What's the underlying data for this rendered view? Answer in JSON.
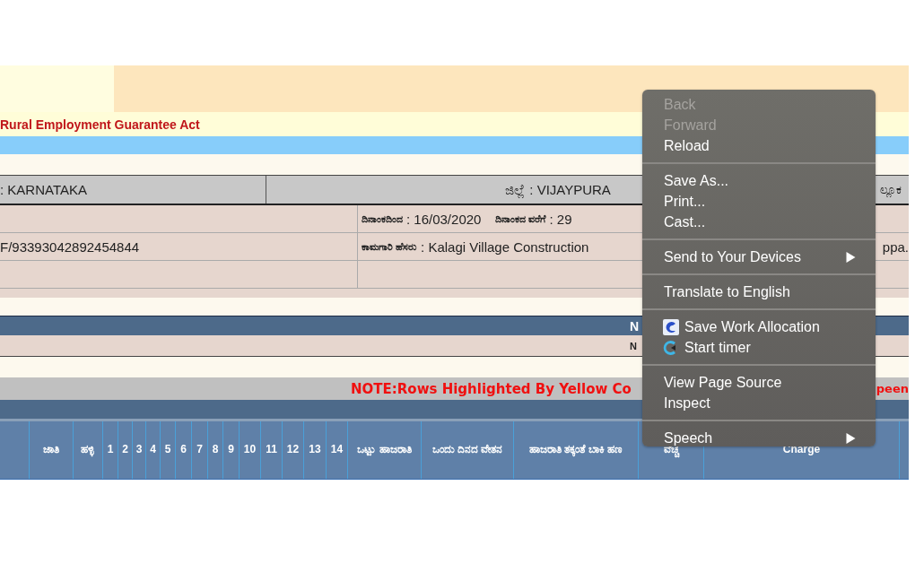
{
  "page": {
    "act_title": "Rural Employment Guarantee Act",
    "location_row": {
      "state": ": KARNATAKA",
      "district": "ಜಿಲ್ಲೆ : VIJAYPURA",
      "taluk": "ಲ್ಲೂಕ"
    },
    "date_row": {
      "from_label": "ದಿನಾಂಕದಿಂದ",
      "from_value": ": 16/03/2020",
      "to_label": "ದಿನಾಂಕದ ವರೆಗೆ",
      "to_value": ": 29"
    },
    "work_row": {
      "work_code": "F/93393042892454844",
      "name_label": "ಕಾಮಗಾರಿ ಹೆಸರು",
      "name_value": ": Kalagi Village Construction",
      "right_text": "ppa."
    },
    "bar_text": "N",
    "sub_bar_text": "N",
    "note": "NOTE:Rows Highlighted By Yellow Co",
    "note_right": "peen",
    "columns": [
      "",
      "ಜಾತಿ",
      "ಹಳ್ಳಿ",
      "1",
      "2",
      "3",
      "4",
      "5",
      "6",
      "7",
      "8",
      "9",
      "10",
      "11",
      "12",
      "13",
      "14",
      "ಒಟ್ಟು ಹಾಜರಾತಿ",
      "ಒಂದು ದಿನದ ವೇತನ",
      "ಹಾಜರಾತಿ ತಕ್ಕಂತೆ ಬಾಕಿ ಹಣ",
      "ವೆಚ್ಚ",
      "Charge"
    ]
  },
  "context_menu": {
    "sections": [
      [
        {
          "label": "Back",
          "kind": "plain",
          "disabled": true
        },
        {
          "label": "Forward",
          "kind": "plain",
          "disabled": true
        },
        {
          "label": "Reload",
          "kind": "plain",
          "disabled": false
        }
      ],
      [
        {
          "label": "Save As...",
          "kind": "plain",
          "disabled": false
        },
        {
          "label": "Print...",
          "kind": "plain",
          "disabled": false
        },
        {
          "label": "Cast...",
          "kind": "plain",
          "disabled": false
        }
      ],
      [
        {
          "label": "Send to Your Devices",
          "kind": "submenu",
          "disabled": false
        }
      ],
      [
        {
          "label": "Translate to English",
          "kind": "plain",
          "disabled": false
        }
      ],
      [
        {
          "label": "Save Work Allocation",
          "kind": "app",
          "disabled": false
        },
        {
          "label": "Start timer",
          "kind": "timer",
          "disabled": false
        }
      ],
      [
        {
          "label": "View Page Source",
          "kind": "plain",
          "disabled": false
        },
        {
          "label": "Inspect",
          "kind": "plain",
          "disabled": false
        }
      ],
      [
        {
          "label": "Speech",
          "kind": "submenu",
          "disabled": false
        }
      ]
    ]
  }
}
